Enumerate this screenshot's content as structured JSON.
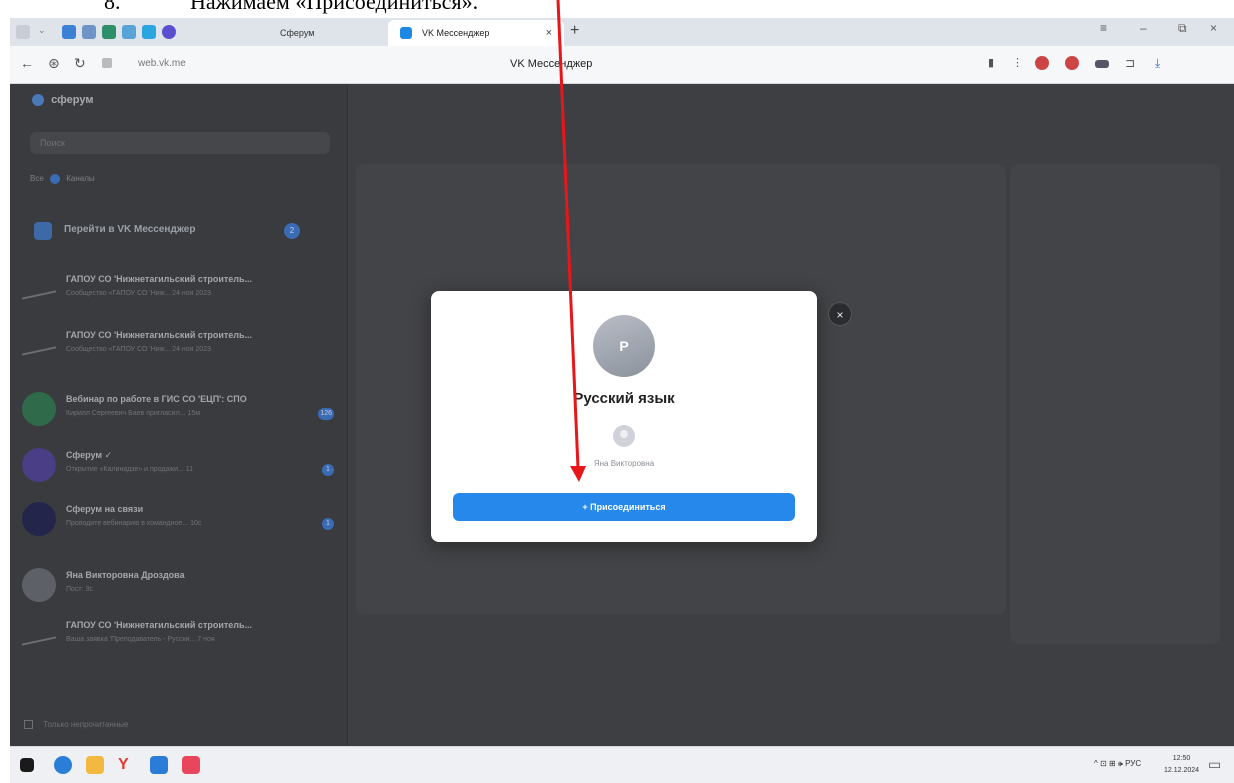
{
  "caption": {
    "number": "8.",
    "text": "Нажимаем «Присоединиться»."
  },
  "browser": {
    "tab_inactive": "Сферум",
    "tab_active": "VK Мессенджер",
    "tab_close": "×",
    "new_tab": "+",
    "url": "web.vk.me",
    "page_title": "VK Мессенджер",
    "window_controls": [
      "≡",
      "–",
      "⧉",
      "×"
    ]
  },
  "sidebar": {
    "header": "сферум",
    "search_placeholder": "Поиск",
    "filter_all": "Все",
    "filter_all_count": "2",
    "filter_channels": "Каналы",
    "goto_label": "Перейти в VK Мессенджер",
    "goto_badge": "2",
    "chats": [
      {
        "name": "ГАПОУ СО 'Нижнетагильский строитель...",
        "preview": "Сообщество «ГАПОУ СО 'Ниж... 24 ноя 2023",
        "badge": ""
      },
      {
        "name": "ГАПОУ СО 'Нижнетагильский строитель...",
        "preview": "Сообщество «ГАПОУ СО 'Ниж... 24 ноя 2023",
        "badge": ""
      },
      {
        "name": "Вебинар по работе в ГИС СО 'ЕЦП': СПО",
        "preview": "Кирилл Сергеевич Баев пригласил... 15м",
        "badge": "126"
      },
      {
        "name": "Сферум ✓",
        "preview": "Открытие «Калинадзе» и продажи... 11",
        "badge": "1"
      },
      {
        "name": "Сферум на связи",
        "preview": "Проводите вебинарию в командное... 10с",
        "badge": "1"
      },
      {
        "name": "Яна Викторовна Дроздова",
        "preview": "Пост: 3с",
        "badge": ""
      },
      {
        "name": "ГАПОУ СО 'Нижнетагильский строитель...",
        "preview": "Ваша заявка 'Преподаватель - Русски... 7 ноя",
        "badge": ""
      }
    ],
    "footer": "Только непрочитанные"
  },
  "modal": {
    "avatar_letter": "Р",
    "title": "Русский язык",
    "owner": "Яна Викторовна",
    "join_label": "+ Присоединиться",
    "close": "×"
  },
  "taskbar": {
    "tray": "^ ⊡ ⊞ 🕪 РУС",
    "time": "12:50",
    "date": "12.12.2024"
  },
  "colors": {
    "accent": "#2688eb",
    "overlay": "#3e3f42",
    "arrow": "#e8161b"
  }
}
